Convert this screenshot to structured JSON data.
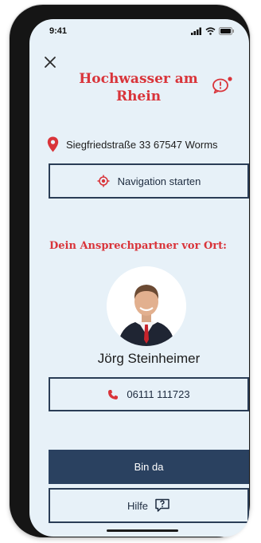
{
  "status_bar": {
    "time": "9:41",
    "icons": [
      "signal-icon",
      "wifi-icon",
      "battery-icon"
    ]
  },
  "header": {
    "close_icon": "close-icon",
    "title": "Hochwasser am Rhein",
    "chat_icon": "chat-alert-icon"
  },
  "location": {
    "icon": "location-pin-icon",
    "address": "Siegfriedstraße 33 67547 Worms"
  },
  "navigation": {
    "icon": "target-icon",
    "label": "Navigation starten"
  },
  "contact": {
    "heading": "Dein Ansprechpartner vor Ort:",
    "name": "Jörg Steinheimer",
    "phone_icon": "phone-icon",
    "phone": "06111 111723"
  },
  "actions": {
    "primary_label": "Bin da",
    "help_label": "Hilfe",
    "help_icon": "help-bubble-icon"
  },
  "colors": {
    "accent": "#d9343a",
    "navy": "#2a4160",
    "background": "#e7f1f8"
  }
}
